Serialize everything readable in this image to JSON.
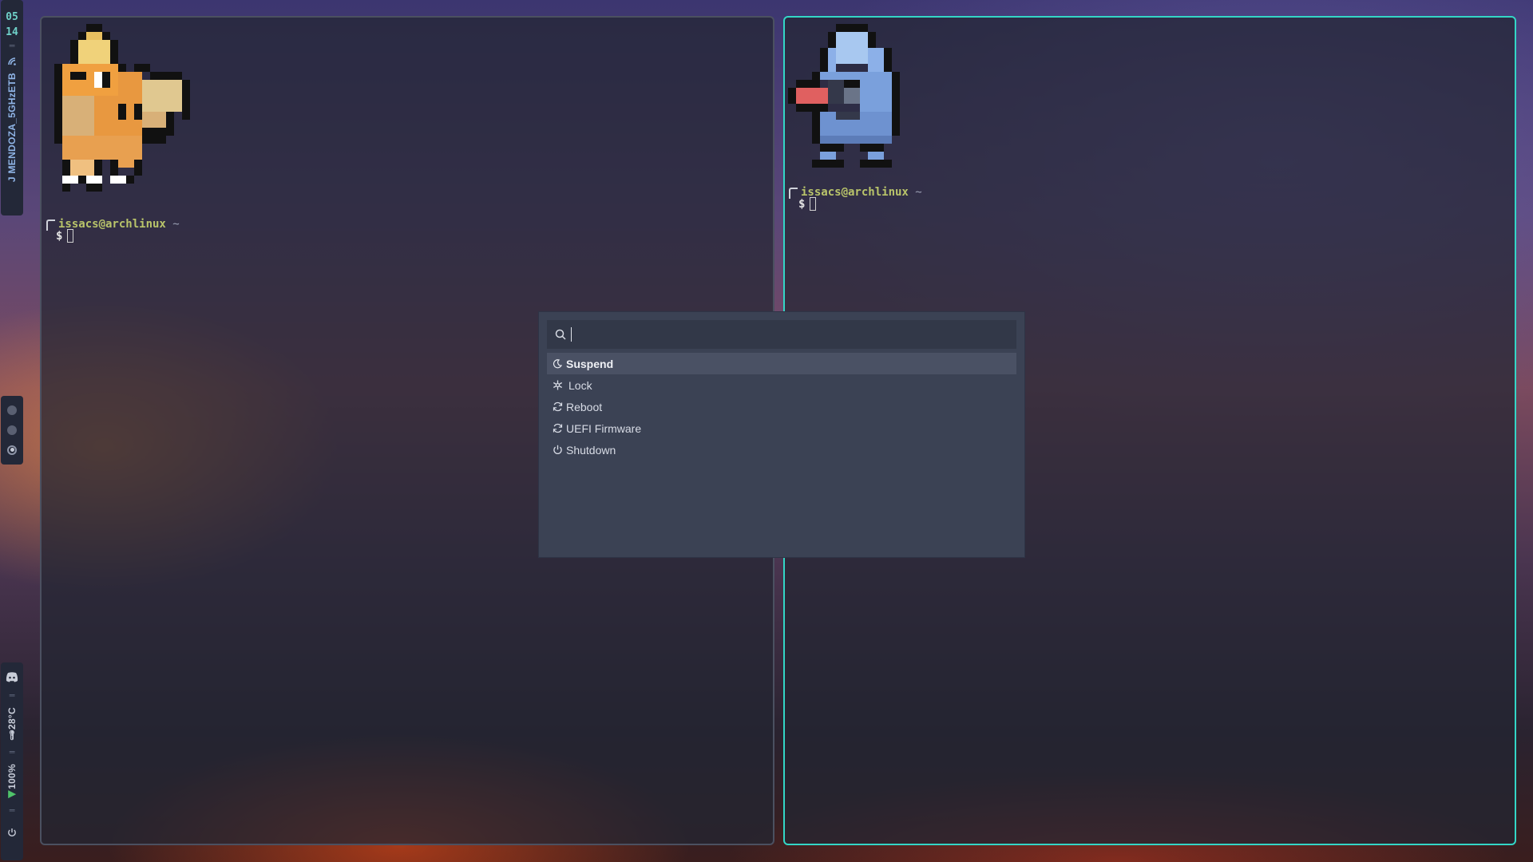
{
  "bar": {
    "clock_hour": "05",
    "clock_minute": "14",
    "network": "J MENDOZA_5GHzETB",
    "temperature": "28°C",
    "volume": "100%"
  },
  "terminals": [
    {
      "user_host": "issacs@archlinux",
      "path": "~",
      "symbol": "$"
    },
    {
      "user_host": "issacs@archlinux",
      "path": "~",
      "symbol": "$"
    }
  ],
  "launcher": {
    "query": "",
    "items": [
      {
        "label": "Suspend",
        "icon": "moon-icon"
      },
      {
        "label": "Lock",
        "icon": "snowflake-icon"
      },
      {
        "label": "Reboot",
        "icon": "refresh-icon"
      },
      {
        "label": "UEFI Firmware",
        "icon": "refresh-icon"
      },
      {
        "label": "Shutdown",
        "icon": "power-icon"
      }
    ]
  },
  "colors": {
    "active_border": "#33d6c6",
    "user_host": "#b9c46a",
    "clock": "#6fd0c8"
  }
}
